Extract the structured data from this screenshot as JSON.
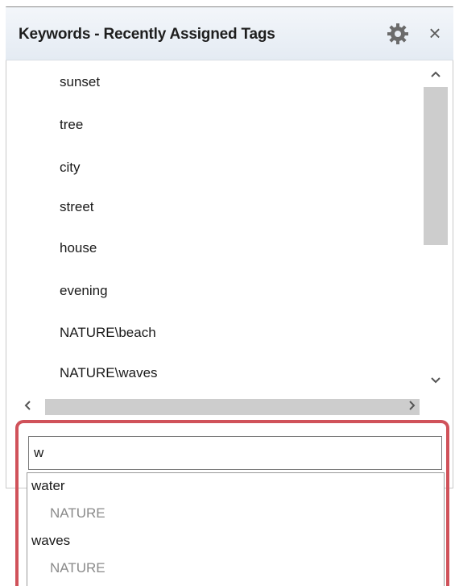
{
  "panel": {
    "title": "Keywords - Recently Assigned Tags",
    "gear_icon": "gear-icon",
    "close_label": "×"
  },
  "keywords": [
    "sunset",
    "tree",
    "city",
    "street",
    "house",
    "evening",
    "NATURE\\beach",
    "NATURE\\waves"
  ],
  "scrollbar": {
    "up": "^",
    "down": "v",
    "left": "<",
    "right": ">"
  },
  "search": {
    "value": "w"
  },
  "suggestions": [
    {
      "name": "water",
      "path": "NATURE"
    },
    {
      "name": "waves",
      "path": "NATURE"
    }
  ],
  "colors": {
    "highlight": "#d0525a",
    "thumb": "#cdcdcd"
  }
}
